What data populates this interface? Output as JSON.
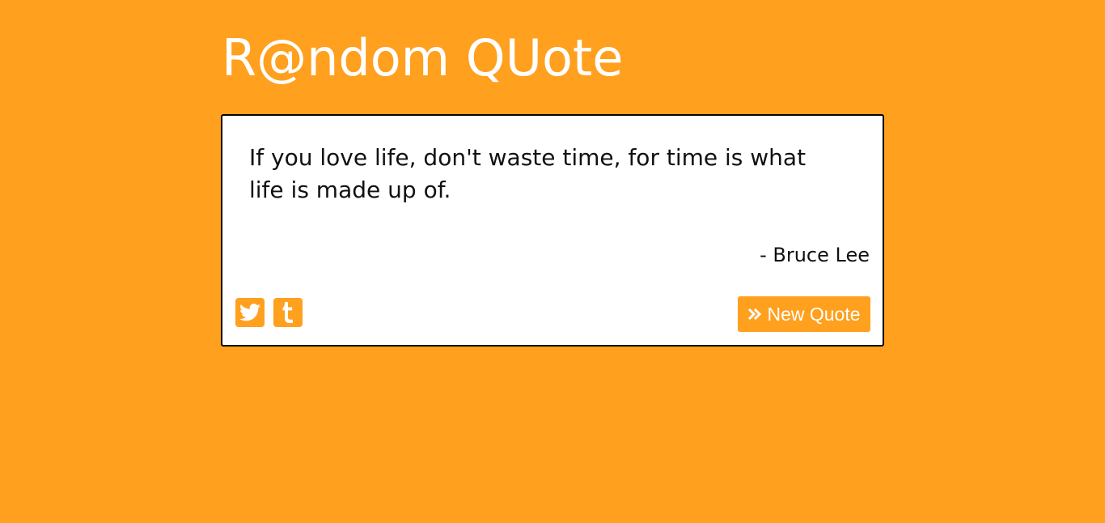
{
  "header": {
    "title": "R@ndom QUote"
  },
  "quote": {
    "text": "If you love life, don't waste time, for time is what life is made up of.",
    "author": "- Bruce Lee"
  },
  "actions": {
    "twitter_icon": "twitter-icon",
    "tumblr_icon": "tumblr-icon",
    "new_quote_label": "New Quote",
    "new_quote_icon": "double-chevron-right-icon"
  },
  "colors": {
    "background": "#FFA01E",
    "card": "#FFFFFF",
    "text": "#111111"
  }
}
